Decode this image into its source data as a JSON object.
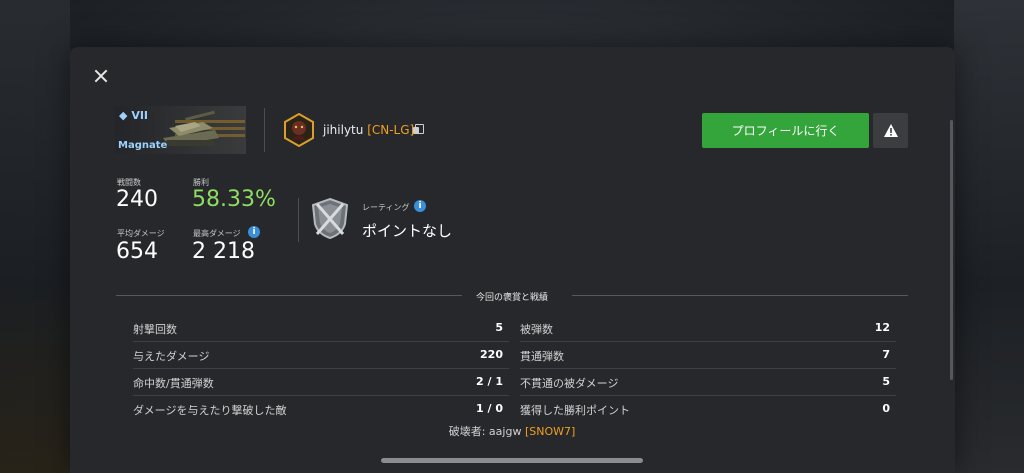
{
  "tank": {
    "tier": "VII",
    "name": "Magnate"
  },
  "player": {
    "name": "jihilytu",
    "clan": "[CN-LG]"
  },
  "buttons": {
    "profile": "プロフィールに行く"
  },
  "stats": {
    "battles_label": "戦闘数",
    "battles": "240",
    "winrate_label": "勝利",
    "winrate": "58.33%",
    "avg_damage_label": "平均ダメージ",
    "avg_damage": "654",
    "max_damage_label": "最高ダメージ",
    "max_damage": "2 218"
  },
  "rating": {
    "label": "レーティング",
    "value": "ポイントなし"
  },
  "section": {
    "title": "今回の褒賞と戦績"
  },
  "left_rows": [
    {
      "label": "射撃回数",
      "value": "5"
    },
    {
      "label": "与えたダメージ",
      "value": "220"
    },
    {
      "label": "命中数/貫通弾数",
      "value": "2 / 1"
    },
    {
      "label": "ダメージを与えたり撃破した敵",
      "value": "1 / 0"
    }
  ],
  "right_rows": [
    {
      "label": "被弾数",
      "value": "12"
    },
    {
      "label": "貫通弾数",
      "value": "7"
    },
    {
      "label": "不貫通の被ダメージ",
      "value": "5"
    },
    {
      "label": "獲得した勝利ポイント",
      "value": "0"
    }
  ],
  "destroyed_by": {
    "label": "破壊者:",
    "name": "aajgw",
    "clan": "[SNOW7]"
  },
  "colors": {
    "accent_green": "#33a53a",
    "winrate_green": "#8fdc62",
    "clan_orange": "#f0a020",
    "tier_blue": "#9cd2ff"
  },
  "icons": [
    "close-icon",
    "copy-icon",
    "warning-icon",
    "info-icon",
    "rating-shield-icon",
    "clan-emblem-icon"
  ]
}
